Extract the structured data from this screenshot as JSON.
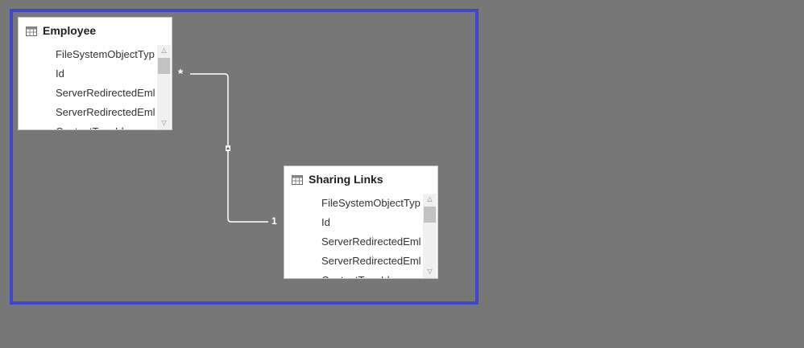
{
  "colors": {
    "canvas": "#777777",
    "selection": "#3f48cc",
    "card": "#ffffff",
    "connector": "#ffffff"
  },
  "tables": [
    {
      "title": "Employee",
      "icon": "table-icon",
      "fields": [
        "FileSystemObjectTyp",
        "Id",
        "ServerRedirectedEml",
        "ServerRedirectedEml",
        "ContentTypeId"
      ]
    },
    {
      "title": "Sharing Links",
      "icon": "table-icon",
      "fields": [
        "FileSystemObjectTyp",
        "Id",
        "ServerRedirectedEml",
        "ServerRedirectedEml",
        "ContentTypeId"
      ]
    }
  ],
  "relationship": {
    "from_cardinality": "*",
    "to_cardinality": "1",
    "filter_direction_icon": "filter-direction-arrow-icon"
  }
}
